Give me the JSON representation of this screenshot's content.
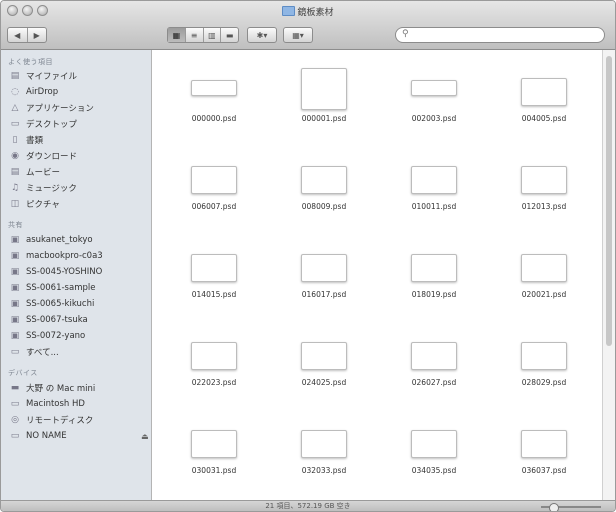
{
  "window": {
    "title": "鏡板素材",
    "title_icon": "folder-icon"
  },
  "toolbar": {
    "back_label": "◀",
    "forward_label": "▶",
    "view_modes": [
      "▦",
      "≡",
      "▥",
      "▬"
    ],
    "action_label": "✱▾",
    "arrange_label": "▦▾",
    "search_placeholder": ""
  },
  "sidebar": {
    "favorites_header": "よく使う項目",
    "favorites": [
      {
        "label": "マイファイル",
        "icon": "all-files-icon"
      },
      {
        "label": "AirDrop",
        "icon": "airdrop-icon"
      },
      {
        "label": "アプリケーション",
        "icon": "applications-icon"
      },
      {
        "label": "デスクトップ",
        "icon": "desktop-icon"
      },
      {
        "label": "書類",
        "icon": "documents-icon"
      },
      {
        "label": "ダウンロード",
        "icon": "downloads-icon"
      },
      {
        "label": "ムービー",
        "icon": "movies-icon"
      },
      {
        "label": "ミュージック",
        "icon": "music-icon"
      },
      {
        "label": "ピクチャ",
        "icon": "pictures-icon"
      }
    ],
    "shared_header": "共有",
    "shared": [
      {
        "label": "asukanet_tokyo",
        "icon": "network-computer-icon"
      },
      {
        "label": "macbookpro-c0a3",
        "icon": "network-computer-icon"
      },
      {
        "label": "SS-0045-YOSHINO",
        "icon": "network-computer-icon"
      },
      {
        "label": "SS-0061-sample",
        "icon": "network-computer-icon"
      },
      {
        "label": "SS-0065-kikuchi",
        "icon": "network-computer-icon"
      },
      {
        "label": "SS-0067-tsuka",
        "icon": "network-computer-icon"
      },
      {
        "label": "SS-0072-yano",
        "icon": "network-computer-icon"
      },
      {
        "label": "すべて...",
        "icon": "all-shared-icon"
      }
    ],
    "devices_header": "デバイス",
    "devices": [
      {
        "label": "大野 の Mac mini",
        "icon": "mac-mini-icon"
      },
      {
        "label": "Macintosh HD",
        "icon": "hard-disk-icon"
      },
      {
        "label": "リモートディスク",
        "icon": "remote-disc-icon"
      },
      {
        "label": "NO NAME",
        "icon": "external-disk-icon",
        "eject": "⏏"
      }
    ]
  },
  "files": [
    {
      "name": "000000.psd",
      "thumb": "wide"
    },
    {
      "name": "000001.psd",
      "thumb": "square"
    },
    {
      "name": "002003.psd",
      "thumb": "wide"
    },
    {
      "name": "004005.psd",
      "thumb": "box"
    },
    {
      "name": "006007.psd",
      "thumb": "box"
    },
    {
      "name": "008009.psd",
      "thumb": "box"
    },
    {
      "name": "010011.psd",
      "thumb": "box"
    },
    {
      "name": "012013.psd",
      "thumb": "box"
    },
    {
      "name": "014015.psd",
      "thumb": "box"
    },
    {
      "name": "016017.psd",
      "thumb": "box"
    },
    {
      "name": "018019.psd",
      "thumb": "box"
    },
    {
      "name": "020021.psd",
      "thumb": "box"
    },
    {
      "name": "022023.psd",
      "thumb": "box"
    },
    {
      "name": "024025.psd",
      "thumb": "box"
    },
    {
      "name": "026027.psd",
      "thumb": "box"
    },
    {
      "name": "028029.psd",
      "thumb": "box"
    },
    {
      "name": "030031.psd",
      "thumb": "box"
    },
    {
      "name": "032033.psd",
      "thumb": "box"
    },
    {
      "name": "034035.psd",
      "thumb": "box"
    },
    {
      "name": "036037.psd",
      "thumb": "box"
    }
  ],
  "status": {
    "text": "21 項目、572.19 GB 空き"
  }
}
